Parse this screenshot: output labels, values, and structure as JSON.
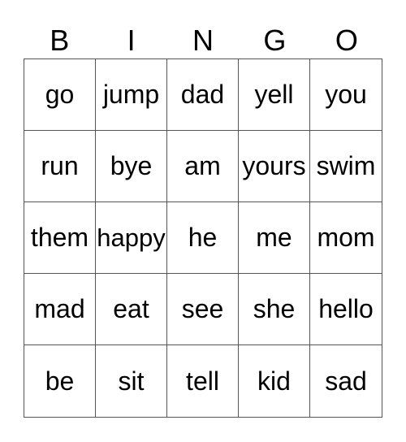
{
  "header": [
    "B",
    "I",
    "N",
    "G",
    "O"
  ],
  "cells": [
    [
      "go",
      "jump",
      "dad",
      "yell",
      "you"
    ],
    [
      "run",
      "bye",
      "am",
      "yours",
      "swim"
    ],
    [
      "them",
      "happy",
      "he",
      "me",
      "mom"
    ],
    [
      "mad",
      "eat",
      "see",
      "she",
      "hello"
    ],
    [
      "be",
      "sit",
      "tell",
      "kid",
      "sad"
    ]
  ]
}
